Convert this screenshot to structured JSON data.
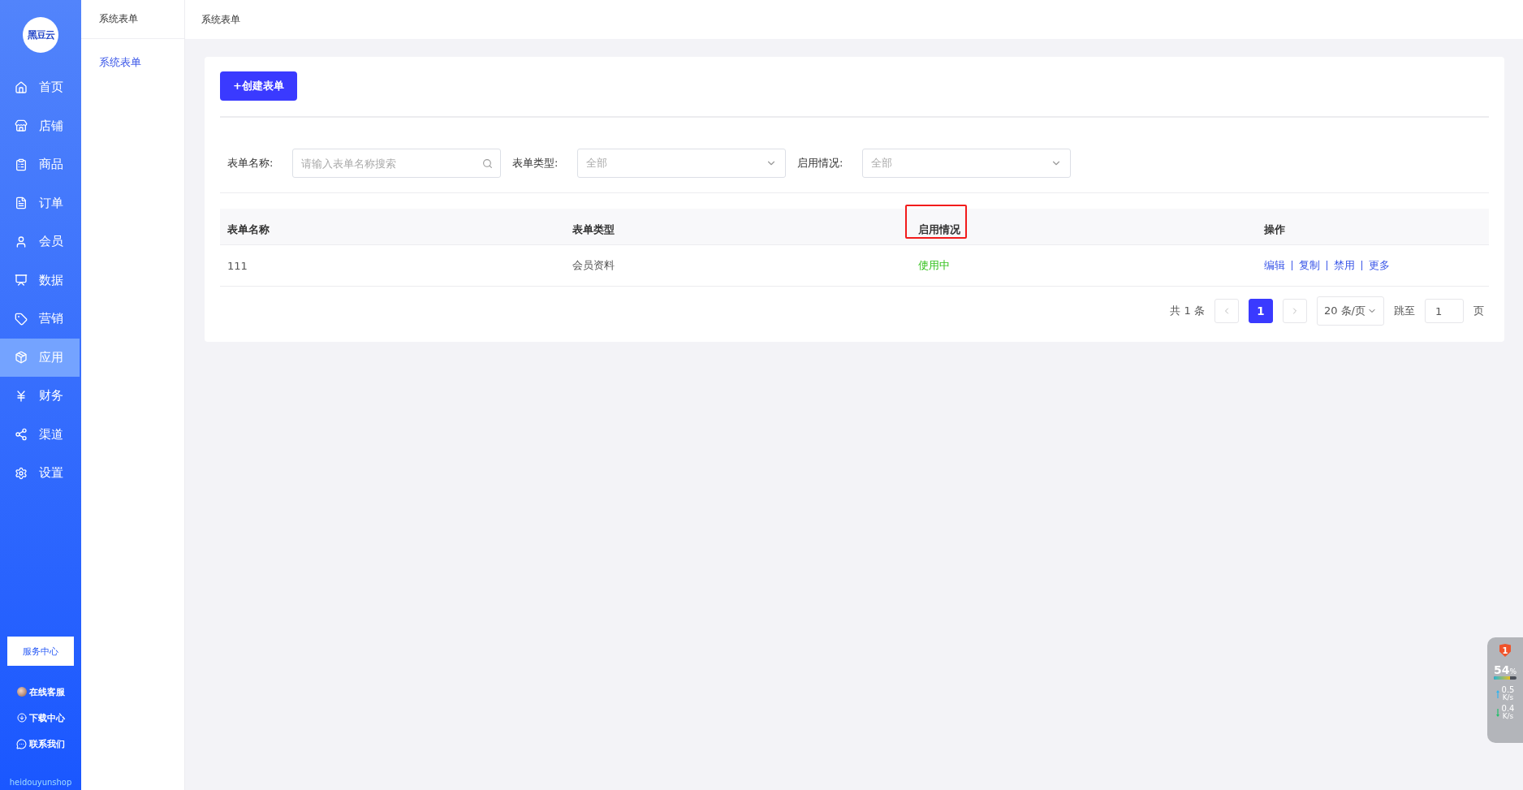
{
  "logo": {
    "text": "黑豆云"
  },
  "nav": [
    {
      "label": "首页",
      "selected": false
    },
    {
      "label": "店铺",
      "selected": false
    },
    {
      "label": "商品",
      "selected": false
    },
    {
      "label": "订单",
      "selected": false
    },
    {
      "label": "会员",
      "selected": false
    },
    {
      "label": "数据",
      "selected": false
    },
    {
      "label": "营销",
      "selected": false
    },
    {
      "label": "应用",
      "selected": true
    },
    {
      "label": "财务",
      "selected": false
    },
    {
      "label": "渠道",
      "selected": false
    },
    {
      "label": "设置",
      "selected": false
    }
  ],
  "service_button": "服务中心",
  "support_links": [
    "在线客服",
    "下载中心",
    "联系我们"
  ],
  "brand_footer": "heidouyunshop",
  "subnav": {
    "title": "系统表单",
    "items": [
      {
        "label": "系统表单",
        "selected": true
      }
    ]
  },
  "breadcrumb": "系统表单",
  "create_button": "+创建表单",
  "filters": [
    {
      "kind": "search",
      "label": "表单名称:",
      "placeholder": "请输入表单名称搜索"
    },
    {
      "kind": "select",
      "label": "表单类型:",
      "value": "全部"
    },
    {
      "kind": "select",
      "label": "启用情况:",
      "value": "全部"
    }
  ],
  "table": {
    "columns": [
      {
        "label": "表单名称",
        "highlighted": false
      },
      {
        "label": "表单类型",
        "highlighted": false
      },
      {
        "label": "启用情况",
        "highlighted": true
      },
      {
        "label": "操作",
        "highlighted": false
      }
    ],
    "rows": [
      {
        "name": "111",
        "type": "会员资料",
        "status": "使用中",
        "actions": [
          "编辑",
          "复制",
          "禁用",
          "更多"
        ]
      }
    ]
  },
  "pagination": {
    "total": "共 1 条",
    "pages": [
      {
        "label": "1",
        "selected": true
      }
    ],
    "page_size": "20 条/页",
    "jump_label": "跳至",
    "jump_value": "1",
    "page_unit": "页"
  },
  "monitor": {
    "badge": "1",
    "percent": "54",
    "percent_unit": "%",
    "level": 0.7,
    "up": "0.5",
    "up_unit": "K/s",
    "down": "0.4",
    "down_unit": "K/s"
  }
}
